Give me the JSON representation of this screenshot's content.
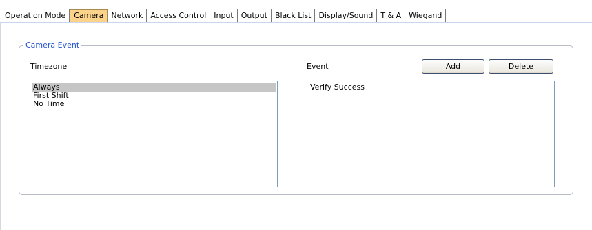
{
  "tabs": [
    {
      "label": "Operation Mode",
      "active": false
    },
    {
      "label": "Camera",
      "active": true
    },
    {
      "label": "Network",
      "active": false
    },
    {
      "label": "Access Control",
      "active": false
    },
    {
      "label": "Input",
      "active": false
    },
    {
      "label": "Output",
      "active": false
    },
    {
      "label": "Black List",
      "active": false
    },
    {
      "label": "Display/Sound",
      "active": false
    },
    {
      "label": "T & A",
      "active": false
    },
    {
      "label": "Wiegand",
      "active": false
    }
  ],
  "camera_event": {
    "group_title": "Camera Event",
    "timezone_label": "Timezone",
    "event_label": "Event",
    "add_label": "Add",
    "delete_label": "Delete",
    "timezone_items": [
      "Always",
      "First Shift",
      "No Time"
    ],
    "selected_timezone": "Always",
    "event_items": [
      "Verify Success"
    ]
  },
  "colors": {
    "active_tab": "#fbd38a",
    "group_title": "#1f4fc9",
    "selection": "#c6c6c6",
    "list_border": "#7f9db9"
  }
}
